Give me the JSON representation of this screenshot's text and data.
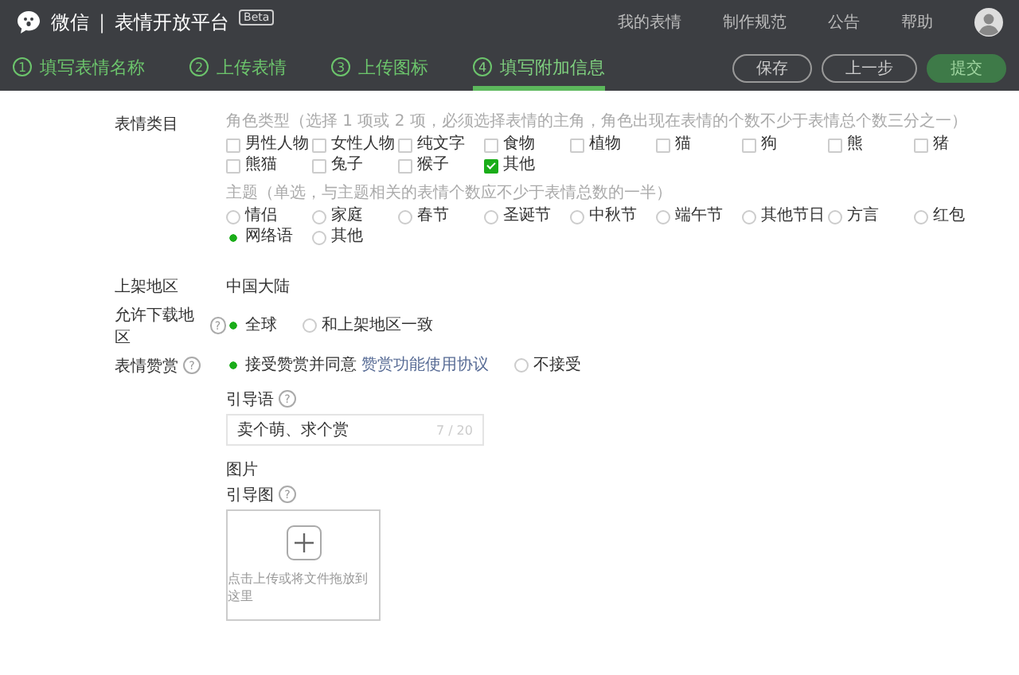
{
  "header": {
    "brand": "微信",
    "divider": "|",
    "title": "表情开放平台",
    "badge": "Beta",
    "nav": [
      "我的表情",
      "制作规范",
      "公告",
      "帮助"
    ]
  },
  "steps": [
    {
      "number": "1",
      "label": "填写表情名称",
      "selected": false
    },
    {
      "number": "2",
      "label": "上传表情",
      "selected": false
    },
    {
      "number": "3",
      "label": "上传图标",
      "selected": false
    },
    {
      "number": "4",
      "label": "填写附加信息",
      "selected": true
    }
  ],
  "actions": [
    {
      "label": "保存",
      "kind": "outline"
    },
    {
      "label": "上一步",
      "kind": "outline"
    },
    {
      "label": "提交",
      "kind": "primary"
    }
  ],
  "category": {
    "label": "表情类目",
    "role_hint": "角色类型（选择 1 项或 2 项，必须选择表情的主角，角色出现在表情的个数不少于表情总个数三分之一）",
    "roles": [
      {
        "label": "男性人物",
        "checked": false
      },
      {
        "label": "女性人物",
        "checked": false
      },
      {
        "label": "纯文字",
        "checked": false
      },
      {
        "label": "食物",
        "checked": false
      },
      {
        "label": "植物",
        "checked": false
      },
      {
        "label": "猫",
        "checked": false
      },
      {
        "label": "狗",
        "checked": false
      },
      {
        "label": "熊",
        "checked": false
      },
      {
        "label": "猪",
        "checked": false
      },
      {
        "label": "熊猫",
        "checked": false
      },
      {
        "label": "兔子",
        "checked": false
      },
      {
        "label": "猴子",
        "checked": false
      },
      {
        "label": "其他",
        "checked": true
      }
    ],
    "theme_hint": "主题（单选，与主题相关的表情个数应不少于表情总数的一半）",
    "themes": [
      {
        "label": "情侣",
        "selected": false
      },
      {
        "label": "家庭",
        "selected": false
      },
      {
        "label": "春节",
        "selected": false
      },
      {
        "label": "圣诞节",
        "selected": false
      },
      {
        "label": "中秋节",
        "selected": false
      },
      {
        "label": "端午节",
        "selected": false
      },
      {
        "label": "其他节日",
        "selected": false
      },
      {
        "label": "方言",
        "selected": false
      },
      {
        "label": "红包",
        "selected": false
      },
      {
        "label": "网络语",
        "selected": true
      },
      {
        "label": "其他",
        "selected": false
      }
    ]
  },
  "region": {
    "label": "上架地区",
    "value": "中国大陆"
  },
  "download": {
    "label": "允许下载地区",
    "help": "?",
    "options": [
      {
        "label": "全球",
        "selected": true
      },
      {
        "label": "和上架地区一致",
        "selected": false
      }
    ]
  },
  "reward": {
    "label": "表情赞赏",
    "help": "?",
    "options": [
      {
        "label": "接受赞赏并同意",
        "link": "赞赏功能使用协议",
        "selected": true
      },
      {
        "label": "不接受",
        "selected": false
      }
    ],
    "guide": {
      "label": "引导语",
      "help": "?",
      "value": "卖个萌、求个赏",
      "counter": "7 / 20"
    },
    "image_section": "图片",
    "guide_image": {
      "label": "引导图",
      "help": "?",
      "upload_hint": "点击上传或将文件拖放到这里"
    }
  }
}
